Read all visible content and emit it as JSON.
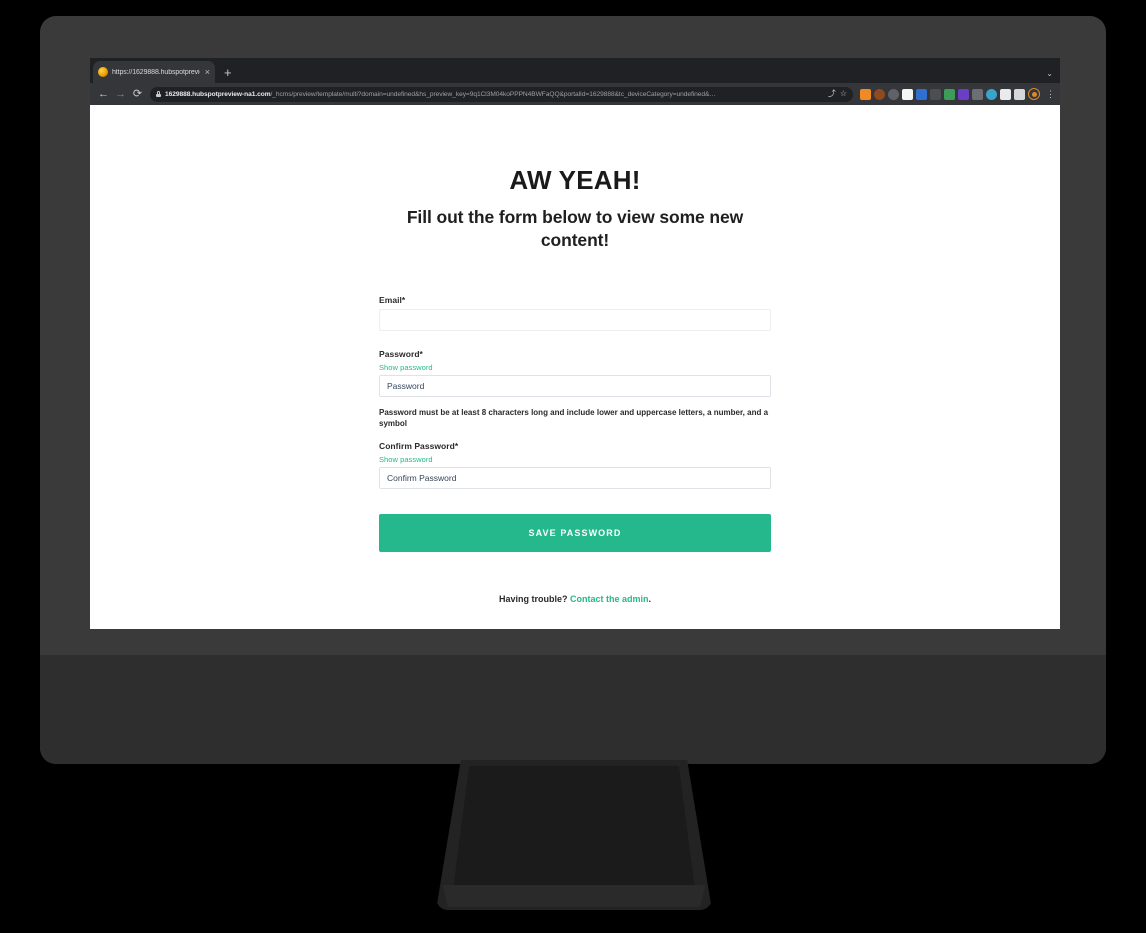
{
  "browser": {
    "tab": {
      "title": "https://1629888.hubspotprevie",
      "favicon": "globe-orange-icon",
      "close_label": "×",
      "new_tab_label": "+",
      "tab_search_label": "⌄"
    },
    "toolbar": {
      "back_label": "←",
      "forward_label": "→",
      "reload_label": "⟳",
      "url_domain": "1629888.hubspotpreview-na1.com",
      "url_path": "/_hcms/preview/template/multi?domain=undefined&hs_preview_key=9q1Cl3M04koPPPN4BWFaQQ&portalId=1629888&tc_deviceCategory=undefined&…",
      "share_label": "⤴",
      "bookmark_label": "☆",
      "menu_label": "⋮",
      "extensions": [
        {
          "name": "extension-icon-1",
          "color": "#f08a24"
        },
        {
          "name": "extension-icon-2",
          "color": "#8e4a20"
        },
        {
          "name": "extension-icon-3",
          "color": "#5f6368"
        },
        {
          "name": "extension-icon-4",
          "color": "#f5f5f5"
        },
        {
          "name": "extension-icon-5",
          "color": "#2f6fd0"
        },
        {
          "name": "extension-icon-6",
          "color": "#4b4f54"
        },
        {
          "name": "extension-icon-7",
          "color": "#3d9c5a"
        },
        {
          "name": "extension-icon-8",
          "color": "#6a3fc4"
        },
        {
          "name": "extension-icon-9",
          "color": "#6b6f73"
        },
        {
          "name": "extension-icon-10",
          "color": "#3aa3c9"
        },
        {
          "name": "extension-icon-11",
          "color": "#e8eaed"
        },
        {
          "name": "extension-icon-12",
          "color": "#d5d7da"
        }
      ]
    }
  },
  "page": {
    "headline": "AW YEAH!",
    "subhead": "Fill out the form below to view some new content!",
    "email": {
      "label": "Email*",
      "value": "",
      "placeholder": ""
    },
    "password": {
      "label": "Password*",
      "show_password_label": "Show password",
      "placeholder": "Password",
      "value": ""
    },
    "help_text": "Password must be at least 8 characters long and include lower and uppercase letters, a number, and a symbol",
    "confirm_password": {
      "label": "Confirm Password*",
      "show_password_label": "Show password",
      "placeholder": "Confirm Password",
      "value": ""
    },
    "submit_label": "SAVE PASSWORD",
    "footer": {
      "prefix": "Having trouble? ",
      "link_label": "Contact the admin",
      "suffix": "."
    },
    "accent_color": "#25b88c"
  }
}
